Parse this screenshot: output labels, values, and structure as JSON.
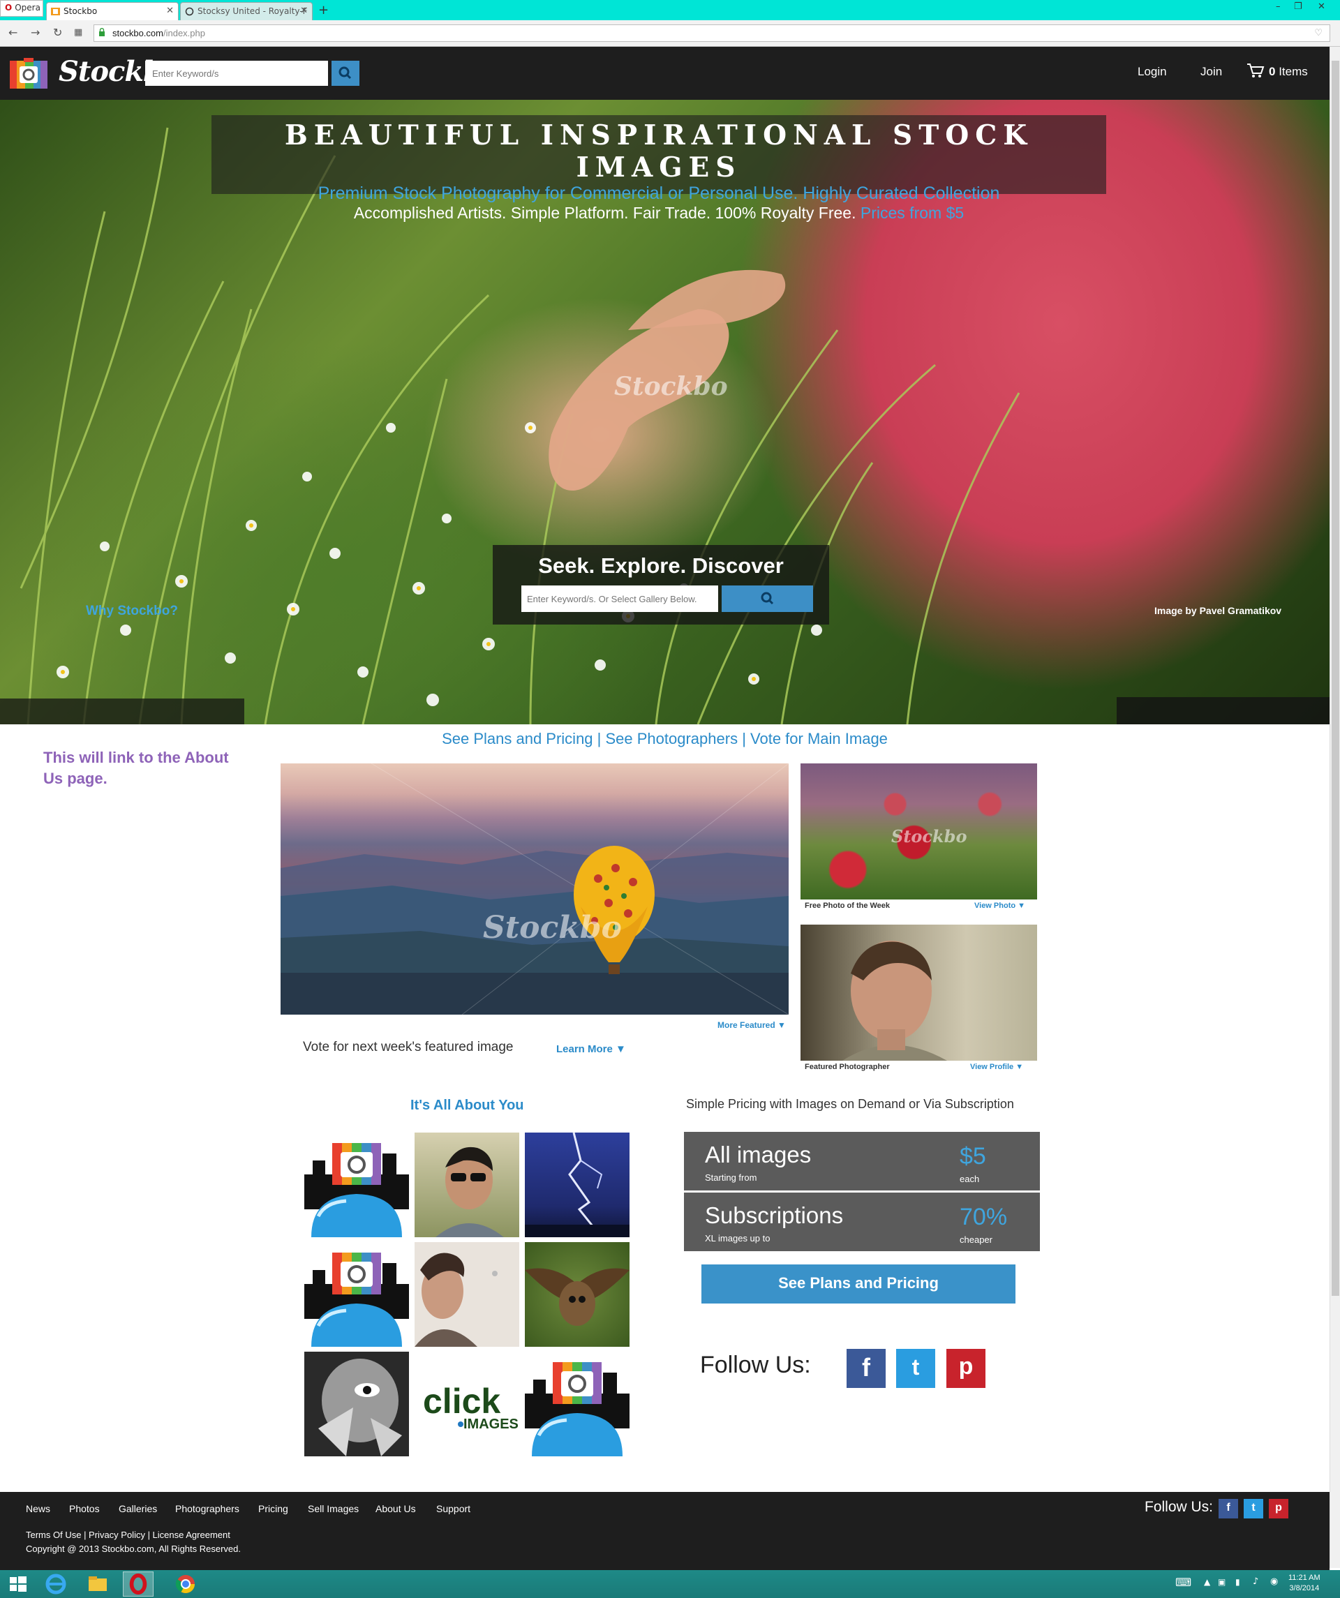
{
  "browser": {
    "menu_label": "Opera",
    "tabs": [
      {
        "label": "Stockbo"
      },
      {
        "label": "Stocksy United - Royalty-F"
      }
    ],
    "new_tab": "+",
    "url_host": "stockbo.com",
    "url_path": "/index.php"
  },
  "header": {
    "logo_text": "Stockbo",
    "search_placeholder": "Enter Keyword/s",
    "login": "Login",
    "join": "Join",
    "cart_count": "0",
    "cart_label": "Items"
  },
  "hero": {
    "title": "BEAUTIFUL INSPIRATIONAL STOCK IMAGES",
    "subtitle": "Premium Stock Photography for Commercial or Personal Use. Highly Curated Collection",
    "tagline": "Accomplished Artists. Simple Platform. Fair Trade. 100% Royalty Free.",
    "tagline_highlight": "Prices from $5",
    "watermark": "Stockbo",
    "seek_title": "Seek. Explore. Discover",
    "seek_placeholder": "Enter Keyword/s. Or Select Gallery Below.",
    "why_link": "Why Stockbo?",
    "credit": "Image by Pavel Gramatikov"
  },
  "content": {
    "top_links": [
      "See Plans and Pricing",
      "See Photographers",
      "Vote for Main Image"
    ],
    "link_separator": " | ",
    "note": "This will link to the About Us page.",
    "more_featured": "More Featured ▼",
    "vote_text": "Vote for next week's featured image",
    "learn_more": "Learn More ▼",
    "free_photo_caption": "Free Photo of the Week",
    "view_photo": "View Photo ▼",
    "featured_photographer_caption": "Featured Photographer",
    "view_profile": "View Profile ▼",
    "about_heading": "It's All About You",
    "click_images_logo": "click IMAGES"
  },
  "pricing": {
    "heading": "Simple Pricing with Images on Demand or Via Subscription",
    "plans": [
      {
        "title": "All images",
        "sub": "Starting from",
        "value": "$5",
        "unit": "each"
      },
      {
        "title": "Subscriptions",
        "sub": "XL images up to",
        "value": "70%",
        "unit": "cheaper"
      }
    ],
    "button": "See Plans and Pricing",
    "follow": "Follow Us:",
    "social": {
      "facebook": "f",
      "twitter": "t",
      "pinterest": "p"
    }
  },
  "footer": {
    "nav": [
      "News",
      "Photos",
      "Galleries",
      "Photographers",
      "Pricing",
      "Sell Images",
      "About Us",
      "Support"
    ],
    "legal": "Terms Of Use | Privacy Policy | License Agreement",
    "copyright": "Copyright @ 2013 Stockbo.com, All Rights Reserved.",
    "follow": "Follow Us:"
  },
  "taskbar": {
    "time": "11:21 AM",
    "date": "3/8/2014"
  },
  "colors": {
    "accent": "#3a92c9",
    "dark": "#1e1e1e",
    "note": "#8e63b8"
  }
}
